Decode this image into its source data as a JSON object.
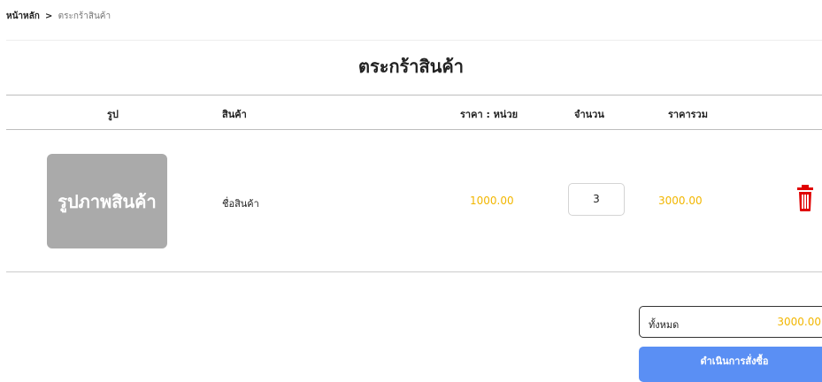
{
  "breadcrumb": {
    "home": "หน้าหลัก",
    "separator": ">",
    "current": "ตระกร้าสินค้า"
  },
  "page": {
    "title": "ตระกร้าสินค้า"
  },
  "table": {
    "headers": {
      "image": "รูป",
      "product": "สินค้า",
      "unit_price": "ราคา : หน่วย",
      "quantity": "จำนวน",
      "total": "ราคารวม"
    },
    "rows": [
      {
        "image_placeholder": "รูปภาพสินค้า",
        "name": "ชื่อสินค้า",
        "price": "1000.00",
        "quantity": "3",
        "total": "3000.00"
      }
    ]
  },
  "summary": {
    "label": "ทั้งหมด",
    "amount": "3000.00"
  },
  "checkout": {
    "label": "ดำเนินการสั่งซื้อ"
  },
  "icons": {
    "delete": "trash-icon"
  },
  "colors": {
    "price": "#f2b600",
    "delete": "#e00000",
    "checkout": "#5a8ff4",
    "image_bg": "#aaaaaa"
  }
}
